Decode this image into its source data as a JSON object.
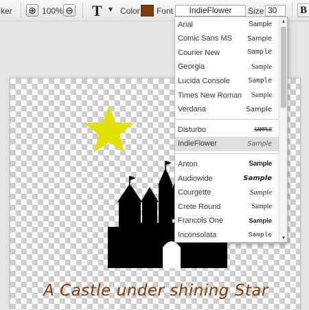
{
  "toolbar": {
    "left_fragment": "ker",
    "zoom_in_symbol": "⊕",
    "zoom_level": "100%",
    "zoom_out_symbol": "⊖",
    "text_tool_glyph": "T",
    "text_tool_caret": "▼",
    "color_label": "Color",
    "color_value": "#7f3c05",
    "font_label": "Font",
    "font_value": "IndieFlower",
    "size_label": "Size",
    "size_value": "30",
    "bold_label": "B"
  },
  "font_dropdown": {
    "sample_text": "Sample",
    "groups": [
      {
        "fonts": [
          {
            "name": "Arial",
            "sample": "Sample",
            "style": "s-arial"
          },
          {
            "name": "Comic Sans MS",
            "sample": "Sample",
            "style": "s-comic"
          },
          {
            "name": "Courier New",
            "sample": "Sample",
            "style": "s-courier"
          },
          {
            "name": "Georgia",
            "sample": "Sample",
            "style": "s-georgia"
          },
          {
            "name": "Lucida Console",
            "sample": "Sample",
            "style": "s-lucida"
          },
          {
            "name": "Times New Roman",
            "sample": "Sample",
            "style": "s-times"
          },
          {
            "name": "Verdana",
            "sample": "Sample",
            "style": "s-verdana"
          }
        ]
      },
      {
        "fonts": [
          {
            "name": "Disturbo",
            "sample": "SAMPLE",
            "style": "s-disturbo"
          },
          {
            "name": "IndieFlower",
            "sample": "Sample",
            "style": "s-indie",
            "selected": true
          }
        ]
      },
      {
        "fonts": [
          {
            "name": "Anton",
            "sample": "Sample",
            "style": "s-anton"
          },
          {
            "name": "Audiowide",
            "sample": "Sample",
            "style": "s-audio"
          },
          {
            "name": "Courgette",
            "sample": "Sample",
            "style": "s-cour2"
          },
          {
            "name": "Crete Round",
            "sample": "Sample",
            "style": "s-crete"
          },
          {
            "name": "Francois One",
            "sample": "Sample",
            "style": "s-franc"
          },
          {
            "name": "Inconsolata",
            "sample": "Sample",
            "style": "s-incon"
          }
        ]
      }
    ],
    "scroll_up": "▲",
    "scroll_down": "▼"
  },
  "canvas": {
    "caption": "A Castle under shining Star",
    "caption_color": "#7f3c05",
    "star_color": "#e2e000",
    "castle_color": "#000000"
  }
}
